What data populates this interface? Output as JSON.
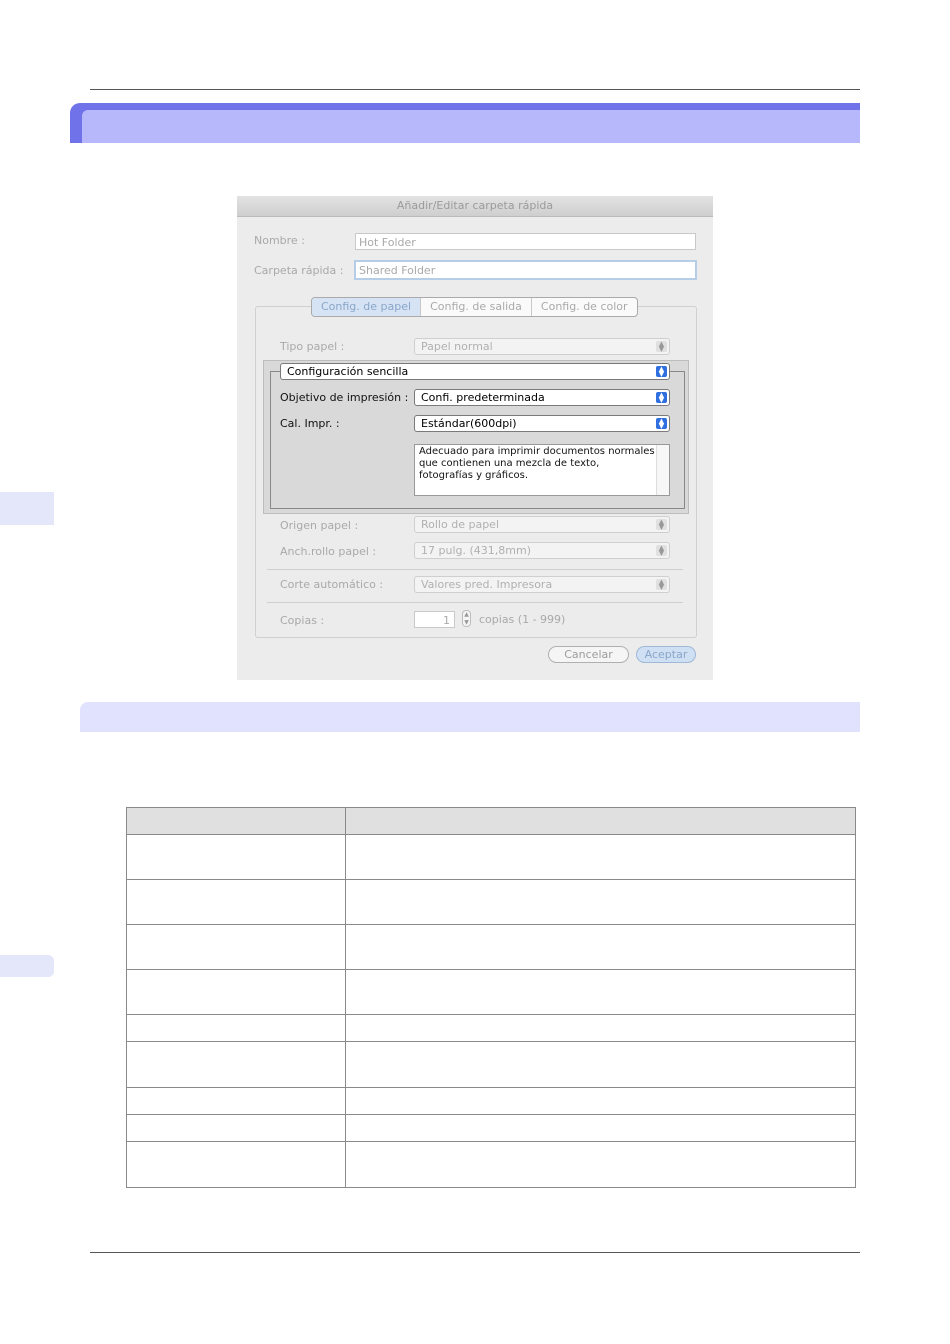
{
  "dialog": {
    "title": "Añadir/Editar carpeta rápida",
    "name_label": "Nombre :",
    "name_value": "Hot Folder",
    "folder_label": "Carpeta rápida :",
    "folder_value": "Shared Folder",
    "tabs": [
      "Config. de papel",
      "Config. de salida",
      "Config. de color"
    ],
    "paper_type_label": "Tipo papel :",
    "paper_type_value": "Papel normal",
    "config_mode_value": "Configuración sencilla",
    "print_goal_label": "Objetivo de impresión :",
    "print_goal_value": "Confi. predeterminada",
    "quality_label": "Cal. Impr. :",
    "quality_value": "Estándar(600dpi)",
    "description": "Adecuado para imprimir documentos normales que contienen una mezcla de texto, fotografías y gráficos.",
    "paper_source_label": "Origen papel :",
    "paper_source_value": "Rollo de papel",
    "roll_width_label": "Anch.rollo papel :",
    "roll_width_value": "17 pulg. (431,8mm)",
    "auto_cut_label": "Corte automático :",
    "auto_cut_value": "Valores pred. Impresora",
    "copies_label": "Copias :",
    "copies_value": "1",
    "copies_range": "copias (1 - 999)",
    "cancel_label": "Cancelar",
    "ok_label": "Aceptar"
  },
  "icons": {
    "select_arrow": "up-down-chevron-icon",
    "stepper": "stepper-icon"
  },
  "colors": {
    "section_header_outer": "#6f72e8",
    "section_header_inner": "#b7b8fb",
    "subheader": "#e1e2fd",
    "side_tab": "#e4e6fa",
    "select_active_arrow": "#2f6fe0"
  }
}
